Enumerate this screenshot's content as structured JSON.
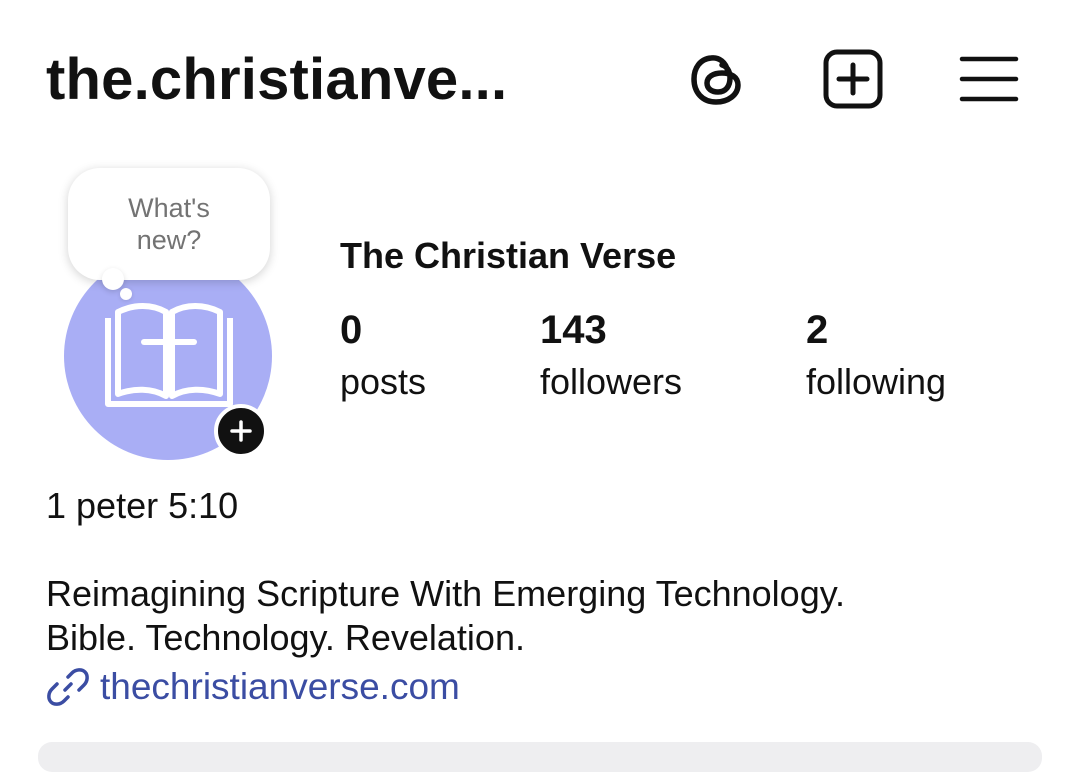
{
  "header": {
    "username": "the.christianve..."
  },
  "icons": {
    "threads": "threads-icon",
    "create": "plus-square-icon",
    "menu": "hamburger-menu-icon",
    "avatar": "open-bible-cross-icon",
    "add_story": "plus-icon",
    "link": "link-icon"
  },
  "note": {
    "text": "What's new?"
  },
  "profile": {
    "display_name": "The Christian Verse",
    "category": "1 peter 5:10",
    "bio_lines": [
      "Reimagining Scripture With Emerging Technology.",
      "Bible. Technology. Revelation."
    ],
    "link": "thechristianverse.com"
  },
  "stats": [
    {
      "value": "0",
      "label": "posts"
    },
    {
      "value": "143",
      "label": "followers"
    },
    {
      "value": "2",
      "label": "following"
    }
  ],
  "colors": {
    "avatar_bg": "#a9aef5",
    "link": "#3b4da3",
    "text": "#111111",
    "muted": "#737373"
  }
}
